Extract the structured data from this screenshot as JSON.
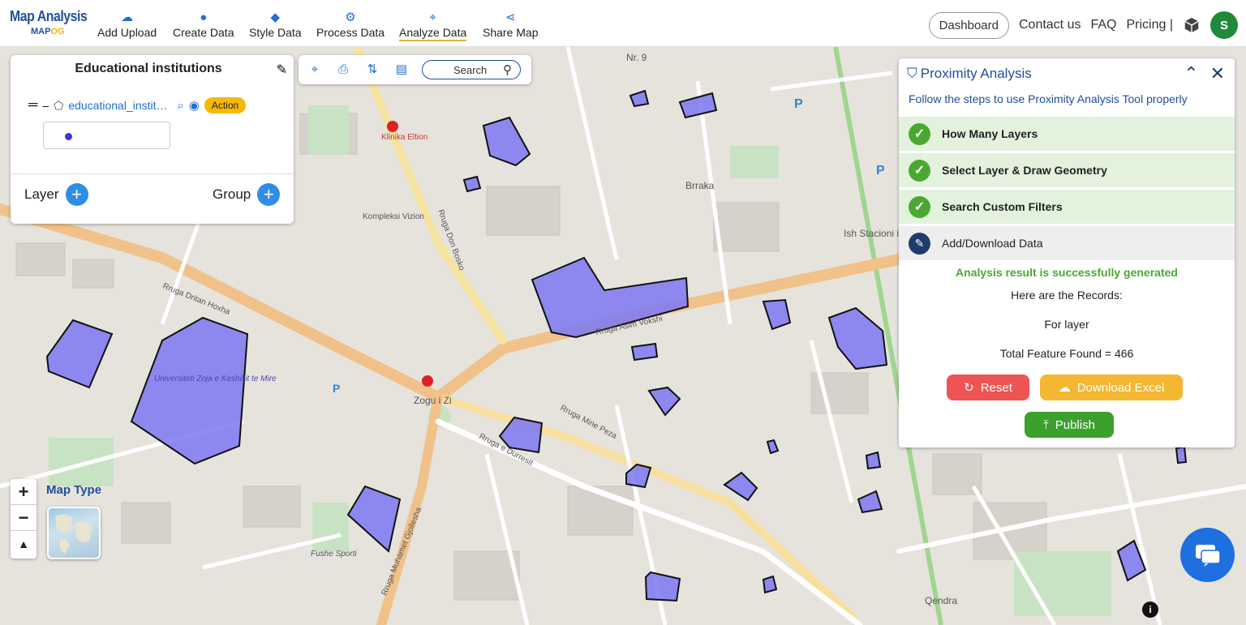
{
  "brand": {
    "title": "Map Analysis",
    "sub_prefix": "MAP",
    "sub_suffix": "OG"
  },
  "nav": [
    {
      "label": "Add Upload",
      "icon": "cloud-upload-icon"
    },
    {
      "label": "Create Data",
      "icon": "location-pin-icon"
    },
    {
      "label": "Style Data",
      "icon": "paint-bucket-icon"
    },
    {
      "label": "Process Data",
      "icon": "process-icon"
    },
    {
      "label": "Analyze Data",
      "icon": "analyze-icon",
      "active": true
    },
    {
      "label": "Share Map",
      "icon": "share-icon"
    }
  ],
  "right_nav": {
    "dashboard": "Dashboard",
    "contact": "Contact us",
    "faq": "FAQ",
    "pricing": "Pricing |",
    "avatar_letter": "S"
  },
  "layer_panel": {
    "title": "Educational institutions",
    "layer_name": "educational_institutions",
    "action_label": "Action",
    "layer_label": "Layer",
    "group_label": "Group"
  },
  "map_tools": {
    "search_label": "Search"
  },
  "proximity": {
    "title": "Proximity Analysis",
    "subtitle": "Follow the steps to use Proximity Analysis Tool properly",
    "steps": [
      {
        "label": "How Many Layers",
        "status": "done"
      },
      {
        "label": "Select Layer & Draw Geometry",
        "status": "done"
      },
      {
        "label": "Search Custom Filters",
        "status": "done"
      },
      {
        "label": "Add/Download Data",
        "status": "active"
      }
    ],
    "success": "Analysis result is successfully generated",
    "records_heading": "Here are the Records:",
    "for_layer": "For layer",
    "total": "Total Feature Found = 466",
    "reset_label": "Reset",
    "excel_label": "Download Excel",
    "publish_label": "Publish"
  },
  "map_labels": {
    "street_1": "Rruga Dritan Hoxha",
    "street_2": "Rruga Asim Vokshi",
    "street_3": "Rruga Mine Peza",
    "street_4": "Rruga e Durresit",
    "street_5": "Rruga Muhamet Gjollesha",
    "street_6": "Rruga Don Bosko",
    "place_1": "Universiteti Zoja e Keshillit te Mire",
    "place_2": "Zogu i Zi",
    "place_3": "Brraka",
    "place_4": "Kompleksi Vizion",
    "place_5": "Ish Stacioni i Trenit",
    "place_6": "Qendra",
    "place_7": "Fushe Sporti",
    "place_8": "Nr. 9",
    "place_9": "Klinika Eltion"
  },
  "map_type": {
    "label": "Map Type"
  },
  "colors": {
    "accent": "#1f4f9a",
    "polygon_fill": "#7b78f2",
    "success": "#4aa832",
    "reset": "#ee5454",
    "excel": "#f4b731"
  }
}
